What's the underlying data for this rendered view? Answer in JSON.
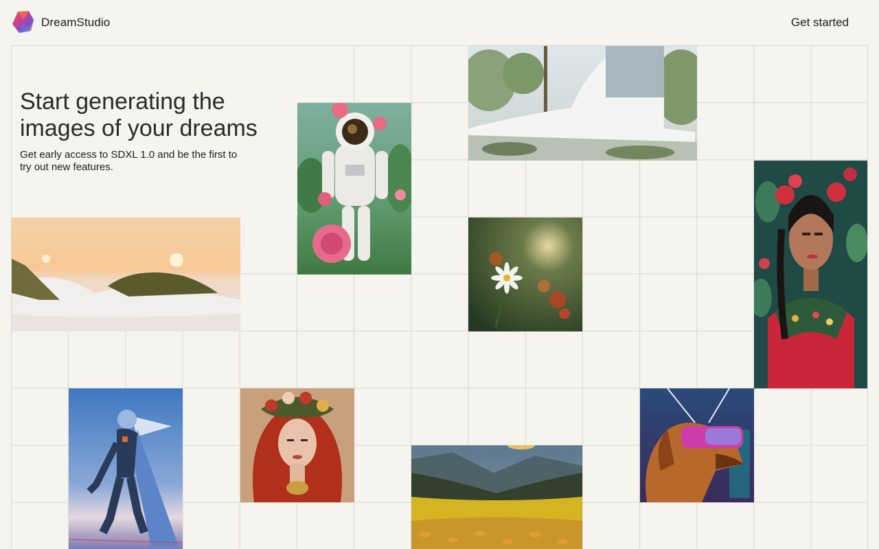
{
  "header": {
    "brand": "DreamStudio",
    "cta_label": "Get started"
  },
  "hero": {
    "title": "Start generating the images of your dreams",
    "subtitle": "Get early access to SDXL 1.0 and be the first to try out new features."
  },
  "gallery": {
    "images": [
      {
        "name": "astronaut-roses-image"
      },
      {
        "name": "modern-house-image"
      },
      {
        "name": "beach-dunes-sunset-image"
      },
      {
        "name": "daisy-flower-image"
      },
      {
        "name": "frida-portrait-image"
      },
      {
        "name": "flying-robot-image"
      },
      {
        "name": "red-hair-woman-image"
      },
      {
        "name": "yellow-field-image"
      },
      {
        "name": "vr-dog-image"
      }
    ]
  },
  "colors": {
    "background": "#f6f4ef",
    "grid_line": "#d9d6d0",
    "text": "#1c1c1c"
  }
}
